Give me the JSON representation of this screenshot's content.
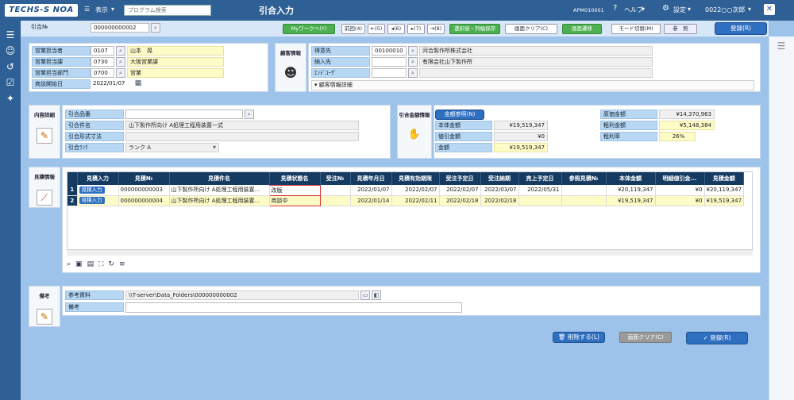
{
  "header": {
    "logo": "TECHS-S NOA",
    "menu_display": "表示",
    "program_search_placeholder": "プログラム検索",
    "title": "引合入力",
    "screen_id": "APM010001",
    "help": "ヘルプ",
    "settings": "設定",
    "user": "0022○○次郎"
  },
  "toolbar": {
    "inquiry_no_label": "引合№",
    "inquiry_no_value": "000000000002",
    "my_work_label": "Myワークへ(Y)",
    "prev_label": "前回(4)",
    "nav_first": "⇤(5)",
    "nav_prev": "◂(6)",
    "nav_next": "▸(7)",
    "nav_last": "⇥(8)",
    "sel_save_label": "選択値・列幅保存",
    "clear_label": "画面クリア(C)",
    "transition_label": "画面遷移",
    "mode_label": "モード切替(M)",
    "ref_label": "参　照",
    "register_label": "登録(R)"
  },
  "sales": {
    "rep_label": "営業担当者",
    "rep_code": "0107",
    "rep_name": "山本　晃",
    "section_label": "営業担当課",
    "section_code": "0730",
    "section_name": "大阪営業課",
    "dept_label": "営業担当部門",
    "dept_code": "0700",
    "dept_name": "営業",
    "start_label": "商談開始日",
    "start_date": "2022/01/07"
  },
  "customer": {
    "title": "顧客情報",
    "customer_label": "得意先",
    "customer_code": "00100010",
    "customer_name": "河合製作所株式会社",
    "delivery_label": "納入先",
    "delivery_name": "有限会社山下製作所",
    "enduser_label": "ｴﾝﾄﾞﾕｰｻﾞ",
    "detail_label": "顧客情報詳細"
  },
  "content": {
    "title": "内容詳細",
    "item_label": "引合品番",
    "name_label": "引合件名",
    "name_value": "山下製作所向け A処理工程用装置一式",
    "spec_label": "引合形式寸法",
    "rank_label": "引合ﾗﾝｸ",
    "rank_value": "ランク A"
  },
  "amount": {
    "title": "引合金額情報",
    "ref_button": "金額参照(N)",
    "body_label": "本体金額",
    "body_value": "¥19,519,347",
    "discount_label": "値引金額",
    "discount_value": "¥0",
    "total_label": "金額",
    "total_value": "¥19,519,347",
    "cost_label": "原価金額",
    "cost_value": "¥14,370,963",
    "profit_label": "粗利金額",
    "profit_value": "¥5,148,384",
    "rate_label": "粗利率",
    "rate_value": "26%"
  },
  "estimate": {
    "title": "見積情報",
    "columns": [
      "見積入力",
      "見積№",
      "見積件名",
      "見積状態名",
      "受注№",
      "見積年月日",
      "見積有効期限",
      "受注予定日",
      "受注納期",
      "売上予定日",
      "参照見積№",
      "本体金額",
      "明細値引金...",
      "見積金額"
    ],
    "rows": [
      {
        "no": "1",
        "btn": "見積入力",
        "est_no": "000000000003",
        "subject": "山下製作所向け A処理工程用装置...",
        "status": "改版",
        "order_no": "",
        "date": "2022/01/07",
        "valid": "2022/02/07",
        "order_plan": "2022/02/07",
        "delivery": "2022/03/07",
        "sales_plan": "2022/05/31",
        "ref_no": "",
        "body": "¥20,119,347",
        "discount": "¥0",
        "amount": "¥20,119,347"
      },
      {
        "no": "2",
        "btn": "見積入力",
        "est_no": "000000000004",
        "subject": "山下製作所向け A処理工程用装置...",
        "status": "商談中",
        "order_no": "",
        "date": "2022/01/14",
        "valid": "2022/02/11",
        "order_plan": "2022/02/18",
        "delivery": "2022/02/18",
        "sales_plan": "",
        "ref_no": "",
        "body": "¥19,519,347",
        "discount": "¥0",
        "amount": "¥19,519,347"
      }
    ]
  },
  "remarks": {
    "title": "備考",
    "ref_label": "参考資料",
    "ref_value": "\\\\T-server\\Data_Folders\\000000000002",
    "note_label": "備考"
  },
  "footer": {
    "delete_label": "削除する(L)",
    "clear_label": "画面クリア(C)",
    "register_label": "登録(R)"
  }
}
